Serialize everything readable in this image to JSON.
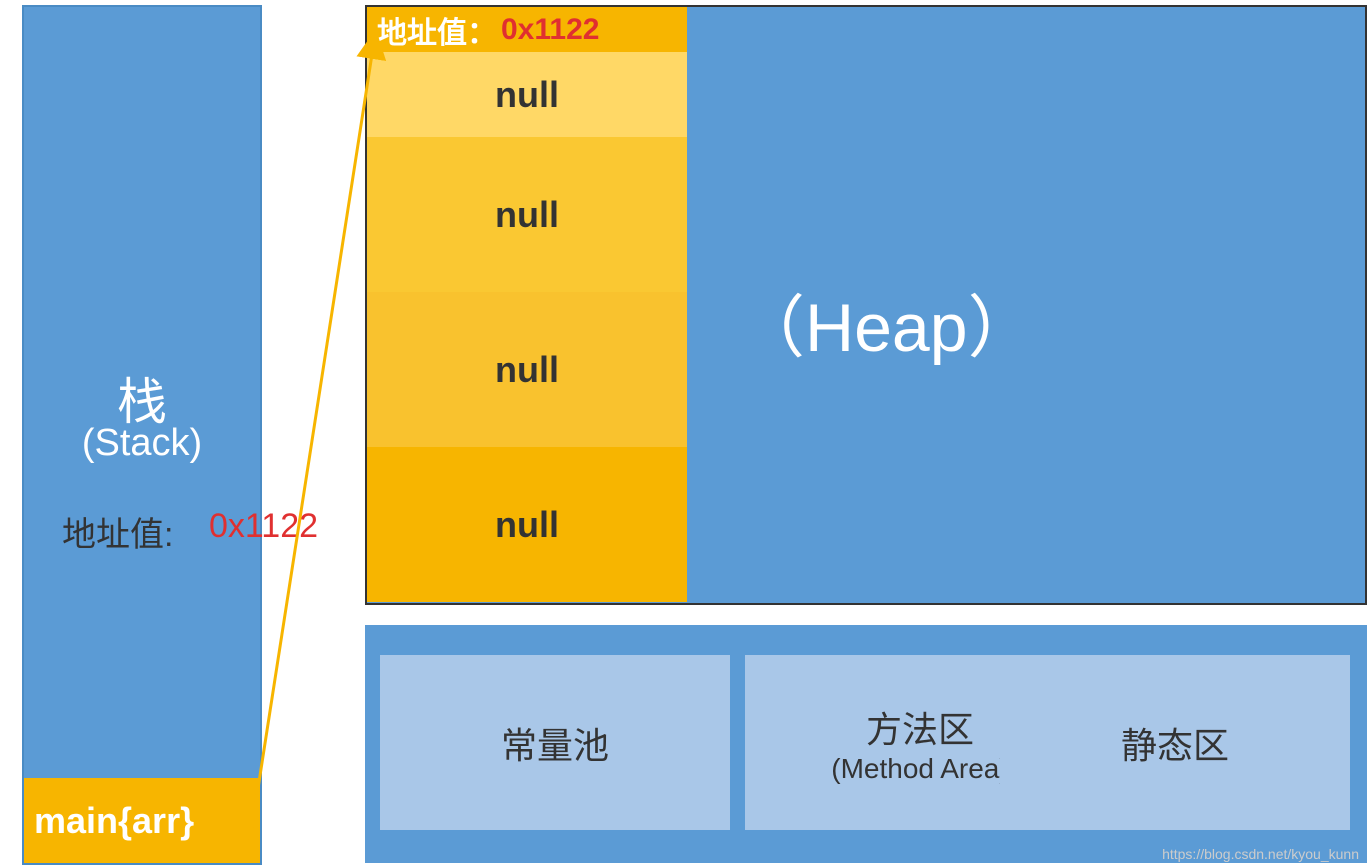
{
  "stack": {
    "title": "栈",
    "subtitle": "(Stack)",
    "addr_label": "地址值:",
    "addr_value": "0x1122",
    "main_label": "main{arr}"
  },
  "heap": {
    "label": "（Heap）",
    "array": {
      "addr_label": "地址值：",
      "addr_value": "0x1122",
      "cells": [
        "null",
        "null",
        "null",
        "null"
      ]
    }
  },
  "method_area": {
    "const_pool": "常量池",
    "method_area_cn": "方法区",
    "method_area_en": "(Method Area)",
    "static_area": "静态区"
  },
  "watermark": "https://blog.csdn.net/kyou_kunn",
  "colors": {
    "primary_blue": "#5b9bd5",
    "light_blue": "#a9c7e8",
    "orange": "#f7b500",
    "red": "#e03030"
  }
}
